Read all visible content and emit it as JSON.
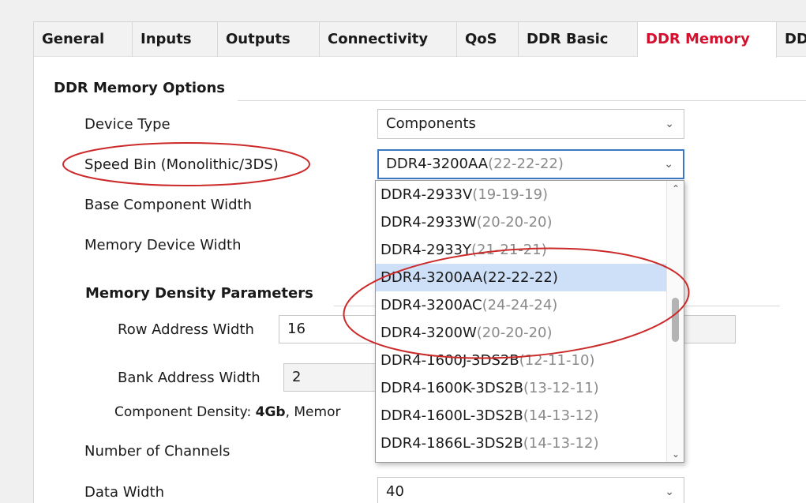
{
  "tabs": [
    {
      "label": "General",
      "active": false
    },
    {
      "label": "Inputs",
      "active": false
    },
    {
      "label": "Outputs",
      "active": false
    },
    {
      "label": "Connectivity",
      "active": false
    },
    {
      "label": "QoS",
      "active": false
    },
    {
      "label": "DDR Basic",
      "active": false
    },
    {
      "label": "DDR Memory",
      "active": true
    },
    {
      "label": "DD",
      "active": false
    }
  ],
  "section": {
    "title": "DDR Memory Options"
  },
  "fields": {
    "device_type": {
      "label": "Device Type",
      "value": "Components"
    },
    "speed_bin": {
      "label": "Speed Bin (Monolithic/3DS)",
      "value_main": "DDR4-3200AA",
      "value_timing": "(22-22-22)"
    },
    "base_component_width": {
      "label": "Base Component Width"
    },
    "memory_device_width": {
      "label": "Memory Device Width"
    },
    "number_of_channels": {
      "label": "Number of Channels"
    },
    "data_width": {
      "label": "Data Width",
      "value": "40"
    }
  },
  "density": {
    "title": "Memory Density Parameters",
    "row_address_width": {
      "label": "Row Address Width",
      "value": "16"
    },
    "bank_address_width": {
      "label": "Bank Address Width",
      "value": "2"
    },
    "component_density_prefix": "Component Density: ",
    "component_density_value": "4Gb",
    "component_density_suffix": ", Memor"
  },
  "dropdown": {
    "options": [
      {
        "main": "DDR4-2933V",
        "timing": "(19-19-19)",
        "selected": false
      },
      {
        "main": "DDR4-2933W",
        "timing": "(20-20-20)",
        "selected": false
      },
      {
        "main": "DDR4-2933Y",
        "timing": "(21-21-21)",
        "selected": false
      },
      {
        "main": "DDR4-3200AA",
        "timing": "(22-22-22)",
        "selected": true
      },
      {
        "main": "DDR4-3200AC",
        "timing": "(24-24-24)",
        "selected": false
      },
      {
        "main": "DDR4-3200W",
        "timing": "(20-20-20)",
        "selected": false
      },
      {
        "main": "DDR4-1600J-3DS2B",
        "timing": "(12-11-10)",
        "selected": false
      },
      {
        "main": "DDR4-1600K-3DS2B",
        "timing": "(13-12-11)",
        "selected": false
      },
      {
        "main": "DDR4-1600L-3DS2B",
        "timing": "(14-13-12)",
        "selected": false
      },
      {
        "main": "DDR4-1866L-3DS2B",
        "timing": "(14-13-12)",
        "selected": false
      }
    ]
  },
  "icons": {
    "chevron": "chevron-down-icon",
    "scroll_up": "scroll-up-icon",
    "scroll_down": "scroll-down-icon"
  },
  "colors": {
    "active_tab": "#d5102e",
    "annotation": "#cc2a2a",
    "focus_border": "#3c78c8",
    "selected_row": "#cde0f7",
    "timing_text": "#8a8a8a"
  }
}
